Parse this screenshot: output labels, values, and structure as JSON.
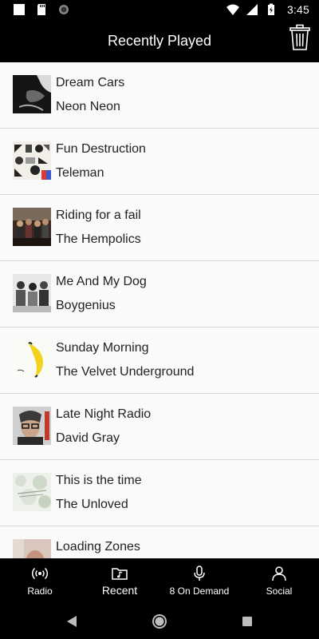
{
  "status_bar": {
    "time": "3:45",
    "icons": [
      "square-notification-icon",
      "sd-card-icon",
      "sync-icon",
      "wifi-icon",
      "signal-icon",
      "battery-icon"
    ]
  },
  "header": {
    "title": "Recently Played",
    "action_icon": "trash-icon"
  },
  "items": [
    {
      "song": "Dream Cars",
      "artist": "Neon Neon"
    },
    {
      "song": "Fun Destruction",
      "artist": "Teleman"
    },
    {
      "song": "Riding for a fail",
      "artist": "The Hempolics"
    },
    {
      "song": "Me And My Dog",
      "artist": "Boygenius"
    },
    {
      "song": "Sunday Morning",
      "artist": "The Velvet Underground"
    },
    {
      "song": "Late Night Radio",
      "artist": "David Gray"
    },
    {
      "song": "This is the time",
      "artist": "The Unloved"
    },
    {
      "song": "Loading Zones",
      "artist": ""
    }
  ],
  "bottom_nav": {
    "tabs": [
      {
        "label": "Radio",
        "icon": "radio-broadcast-icon"
      },
      {
        "label": "Recent",
        "icon": "music-folder-icon"
      },
      {
        "label": "8 On Demand",
        "icon": "microphone-icon"
      },
      {
        "label": "Social",
        "icon": "person-icon"
      }
    ],
    "active": "Recent"
  },
  "colors": {
    "background": "#000000",
    "list_background": "#fafafa",
    "divider": "#d6d6d6",
    "text": "#222222"
  }
}
